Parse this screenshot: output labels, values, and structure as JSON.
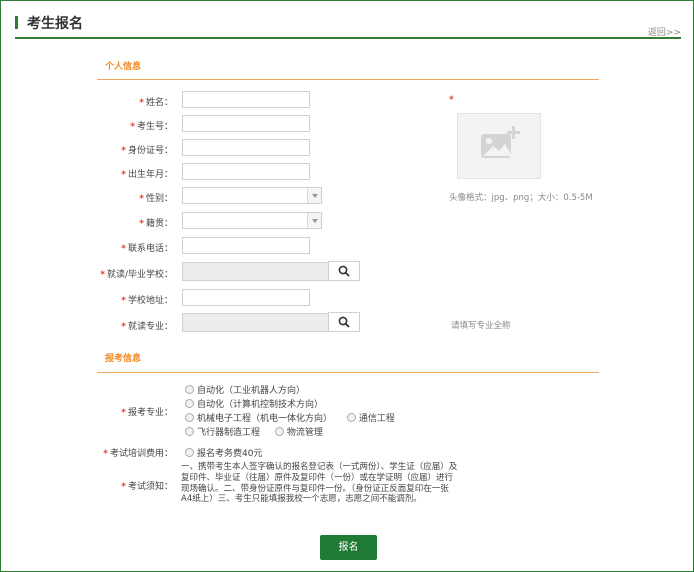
{
  "header": {
    "title": "考生报名",
    "back": "返回>>"
  },
  "sections": {
    "personal": "个人信息",
    "exam": "报考信息"
  },
  "fields": {
    "name": "姓名：",
    "examinee_no": "考生号：",
    "id_no": "身份证号：",
    "birth": "出生年月：",
    "gender": "性别：",
    "native_place": "籍贯：",
    "phone": "联系电话：",
    "school": "就读/毕业学校：",
    "school_addr": "学校地址：",
    "major": "就读专业：",
    "apply_major": "报考专业：",
    "fee": "考试培训费用：",
    "notice": "考试须知："
  },
  "photo": {
    "hint": "头像格式：jpg、png；大小：0.5-5M"
  },
  "major_hint": "请填写专业全称",
  "apply_options": [
    "自动化（工业机器人方向）",
    "自动化（计算机控制技术方向）",
    "机械电子工程（机电一体化方向）",
    "通信工程",
    "飞行器制造工程",
    "物流管理"
  ],
  "fee_option": "报名考务费40元",
  "notice_text": "一、携带考生本人签字确认的报名登记表（一式两份）、学生证（应届）及复印件、毕业证（往届）原件及复印件（一份）或在学证明（应届）进行现场确认。二、带身份证原件与复印件一份。（身份证正反面复印在一张A4纸上）三、考生只能填报我校一个志愿，志愿之间不能调剂。",
  "submit": "报名",
  "colors": {
    "brand": "#2f7d32",
    "accent": "#f08a24",
    "required": "#e23b2e"
  }
}
